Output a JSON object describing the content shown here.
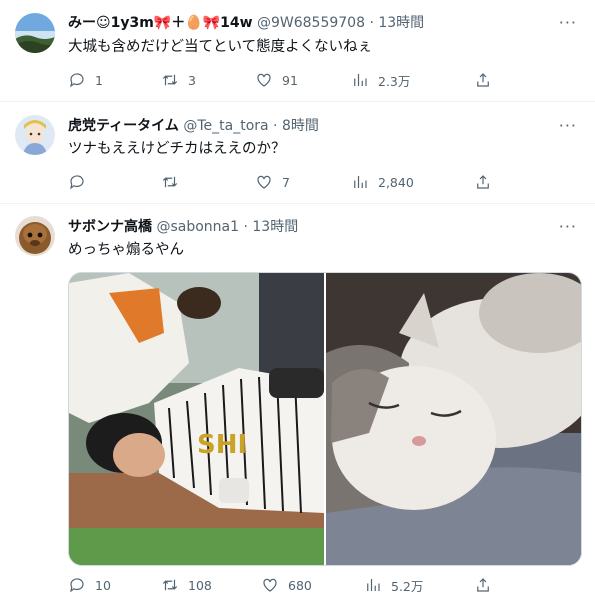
{
  "tweets": [
    {
      "name": "みー☺1y3m🎀＋🥚🎀14w",
      "handle": "@9W68559708",
      "separator": "·",
      "time": "13時間",
      "text": "大城も含めだけど当てといて態度よくないねぇ",
      "replies": "1",
      "retweets": "3",
      "likes": "91",
      "views": "2.3万"
    },
    {
      "name": "虎党ティータイム",
      "handle": "@Te_ta_tora",
      "separator": "·",
      "time": "8時間",
      "text": "ツナもええけどチカはええのか？",
      "replies": "",
      "retweets": "",
      "likes": "7",
      "views": "2,840"
    },
    {
      "name": "サボンナ高橋",
      "handle": "@sabonna1",
      "separator": "·",
      "time": "13時間",
      "text": "めっちゃ煽るやん",
      "replies": "10",
      "retweets": "108",
      "likes": "680",
      "views": "5.2万"
    }
  ],
  "more_label": "···",
  "media": {
    "left_image": "baseball-player-grimacing-on-field-photo",
    "right_image": "sleeping-cat-photo",
    "jersey_text": "SHI"
  },
  "icons": {
    "reply": "reply-icon",
    "retweet": "retweet-icon",
    "like": "like-icon",
    "views": "views-icon",
    "share": "share-icon",
    "more": "more-icon"
  },
  "colors": {
    "text": "#0f1419",
    "secondary": "#536471",
    "border": "#eff3f4"
  }
}
